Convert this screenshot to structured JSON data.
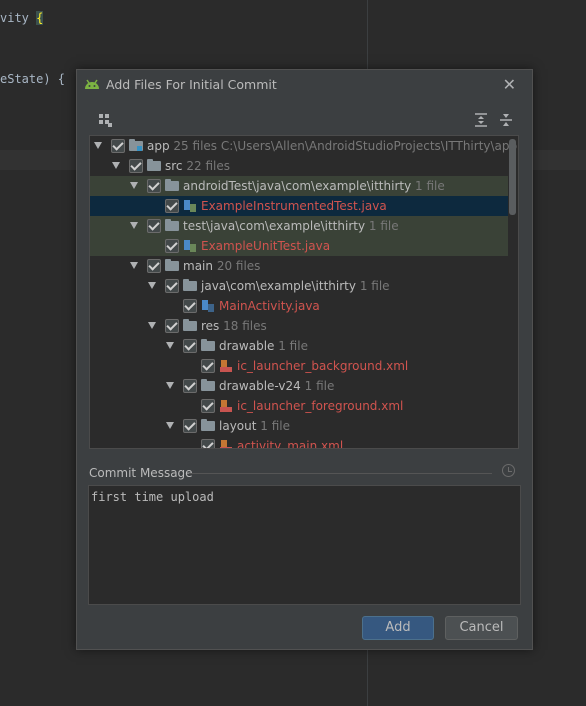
{
  "editor": {
    "line1": "vity ",
    "line1_brace": "{",
    "line2": "eState) {"
  },
  "dialog": {
    "title": "Add Files For Initial Commit",
    "close_glyph": "✕"
  },
  "tree": {
    "rows": [
      {
        "name": "app",
        "sub": "25 files  C:\\Users\\Allen\\AndroidStudioProjects\\ITThirty\\app",
        "kind": "module"
      },
      {
        "name": "src",
        "sub": "22 files",
        "kind": "folder"
      },
      {
        "name": "androidTest\\java\\com\\example\\itthirty",
        "sub": "1 file",
        "kind": "folder"
      },
      {
        "name": "ExampleInstrumentedTest.java",
        "sub": "",
        "kind": "java"
      },
      {
        "name": "test\\java\\com\\example\\itthirty",
        "sub": "1 file",
        "kind": "folder"
      },
      {
        "name": "ExampleUnitTest.java",
        "sub": "",
        "kind": "java"
      },
      {
        "name": "main",
        "sub": "20 files",
        "kind": "folder"
      },
      {
        "name": "java\\com\\example\\itthirty",
        "sub": "1 file",
        "kind": "folder"
      },
      {
        "name": "MainActivity.java",
        "sub": "",
        "kind": "java"
      },
      {
        "name": "res",
        "sub": "18 files",
        "kind": "folder"
      },
      {
        "name": "drawable",
        "sub": "1 file",
        "kind": "folder"
      },
      {
        "name": "ic_launcher_background.xml",
        "sub": "",
        "kind": "xml"
      },
      {
        "name": "drawable-v24",
        "sub": "1 file",
        "kind": "folder"
      },
      {
        "name": "ic_launcher_foreground.xml",
        "sub": "",
        "kind": "xml"
      },
      {
        "name": "layout",
        "sub": "1 file",
        "kind": "folder"
      },
      {
        "name": "activity_main.xml",
        "sub": "",
        "kind": "xml"
      }
    ]
  },
  "commit": {
    "label": "Commit Message",
    "message": "first time upload"
  },
  "buttons": {
    "add": "Add",
    "cancel": "Cancel"
  },
  "colors": {
    "accent": "#365880",
    "unversioned": "#d1544f",
    "selection": "#0d293e"
  }
}
